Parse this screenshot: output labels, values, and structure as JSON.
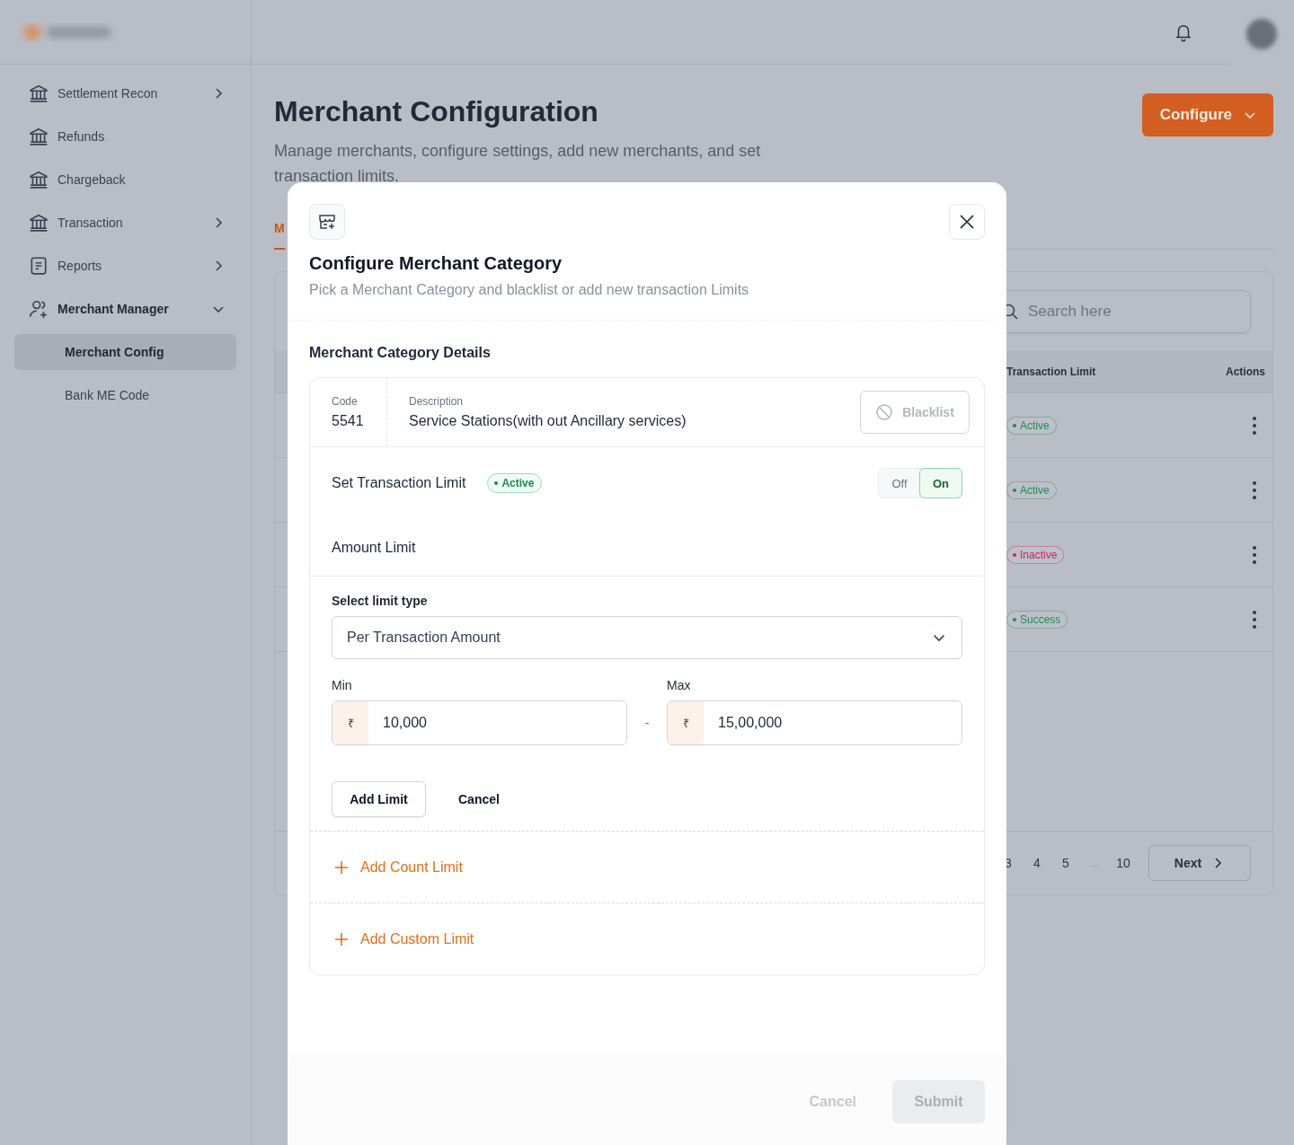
{
  "sidebar": {
    "items": [
      {
        "label": "Settlement Recon",
        "kind": "group",
        "expanded": false
      },
      {
        "label": "Refunds",
        "kind": "link"
      },
      {
        "label": "Chargeback",
        "kind": "link"
      },
      {
        "label": "Transaction",
        "kind": "group",
        "expanded": false
      },
      {
        "label": "Reports",
        "kind": "group",
        "expanded": false
      },
      {
        "label": "Merchant Manager",
        "kind": "group",
        "expanded": true,
        "children": [
          {
            "label": "Merchant Config",
            "selected": true
          },
          {
            "label": "Bank ME Code",
            "selected": false
          }
        ]
      }
    ]
  },
  "page": {
    "title": "Merchant Configuration",
    "description": "Manage merchants, configure settings, add new merchants, and set transaction limits.",
    "configure_button": "Configure",
    "tabs": [
      {
        "label": "M",
        "selected": true
      }
    ],
    "search": {
      "placeholder": "Search here"
    },
    "table": {
      "columns": [
        "Transaction Limit",
        "Actions"
      ],
      "rows": [
        {
          "status": "Active",
          "color": "#1e8a57"
        },
        {
          "status": "Active",
          "color": "#1e8a57"
        },
        {
          "status": "Inactive",
          "color": "#c8265c"
        },
        {
          "status": "Success",
          "color": "#1e8a57"
        }
      ]
    },
    "pagination": {
      "pages": [
        "3",
        "4",
        "5",
        "...",
        "10"
      ],
      "next": "Next"
    }
  },
  "modal": {
    "title": "Configure Merchant Category",
    "subtitle": "Pick a Merchant Category and blacklist or add new transaction Limits",
    "section_title": "Merchant Category Details",
    "category": {
      "code_label": "Code",
      "code": "5541",
      "description_label": "Description",
      "description": "Service Stations(with out Ancillary services)"
    },
    "blacklist_button": {
      "label": "Blacklist",
      "disabled": true
    },
    "transaction_limit": {
      "label": "Set Transaction Limit",
      "status": "Active",
      "color": "#1e8a57",
      "toggle": {
        "off_label": "Off",
        "on_label": "On",
        "on": true
      }
    },
    "amount_limit": "Amount Limit",
    "limit_type": {
      "label": "Select limit type",
      "value": "Per Transaction Amount"
    },
    "min": {
      "label": "Min",
      "currency": "₹",
      "value": "10,000"
    },
    "separator": "-",
    "max": {
      "label": "Max",
      "currency": "₹",
      "value": "15,00,000"
    },
    "add_limit_button": "Add Limit",
    "cancel_button": "Cancel",
    "add_links": [
      "Add Count Limit",
      "Add Custom Limit"
    ],
    "footer": {
      "cancel": {
        "label": "Cancel",
        "disabled": true
      },
      "submit": {
        "label": "Submit",
        "disabled": true
      }
    }
  }
}
